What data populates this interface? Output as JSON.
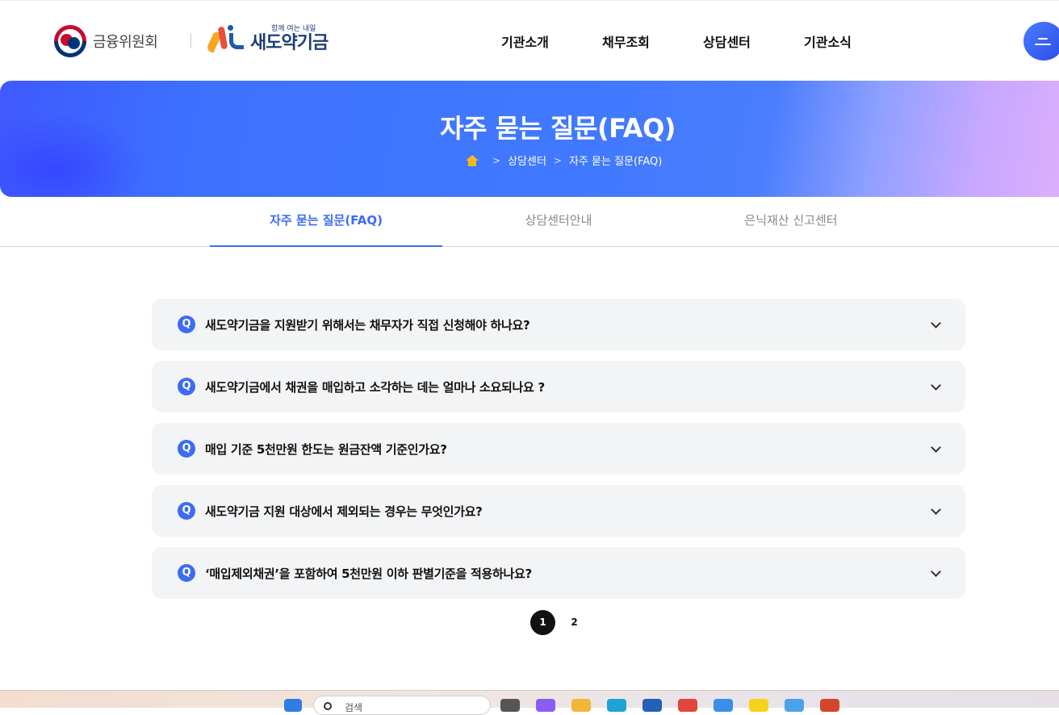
{
  "header": {
    "fsc_name": "금융위원회",
    "brand_sub": "함께 여는 내일",
    "brand_name": "새도약기금",
    "nav": [
      "기관소개",
      "채무조회",
      "상담센터",
      "기관소식"
    ]
  },
  "hero": {
    "title": "자주 묻는 질문(FAQ)",
    "breadcrumb": [
      "상담센터",
      "자주 묻는 질문(FAQ)"
    ],
    "separator": ">"
  },
  "tabs": [
    {
      "label": "자주 묻는 질문(FAQ)",
      "active": true
    },
    {
      "label": "상담센터안내",
      "active": false
    },
    {
      "label": "은닉재산 신고센터",
      "active": false
    }
  ],
  "faq": {
    "badge": "Q",
    "items": [
      "새도약기금을 지원받기 위해서는 채무자가 직접 신청해야 하나요?",
      "새도약기금에서 채권을 매입하고 소각하는 데는 얼마나 소요되나요 ?",
      "매입 기준 5천만원 한도는 원금잔액 기준인가요?",
      "새도약기금 지원 대상에서 제외되는 경우는 무엇인가요?",
      "‘매입제외채권’을 포함하여 5천만원 이하 판별기준을 적용하나요?"
    ]
  },
  "pagination": {
    "pages": [
      "1",
      "2"
    ],
    "current": "1"
  },
  "taskbar": {
    "search_text": "검색"
  },
  "colors": {
    "accent": "#3c6bf6",
    "hero_start": "#3f59ff",
    "hero_end": "#dcaefc",
    "home_icon": "#f5b81c"
  }
}
